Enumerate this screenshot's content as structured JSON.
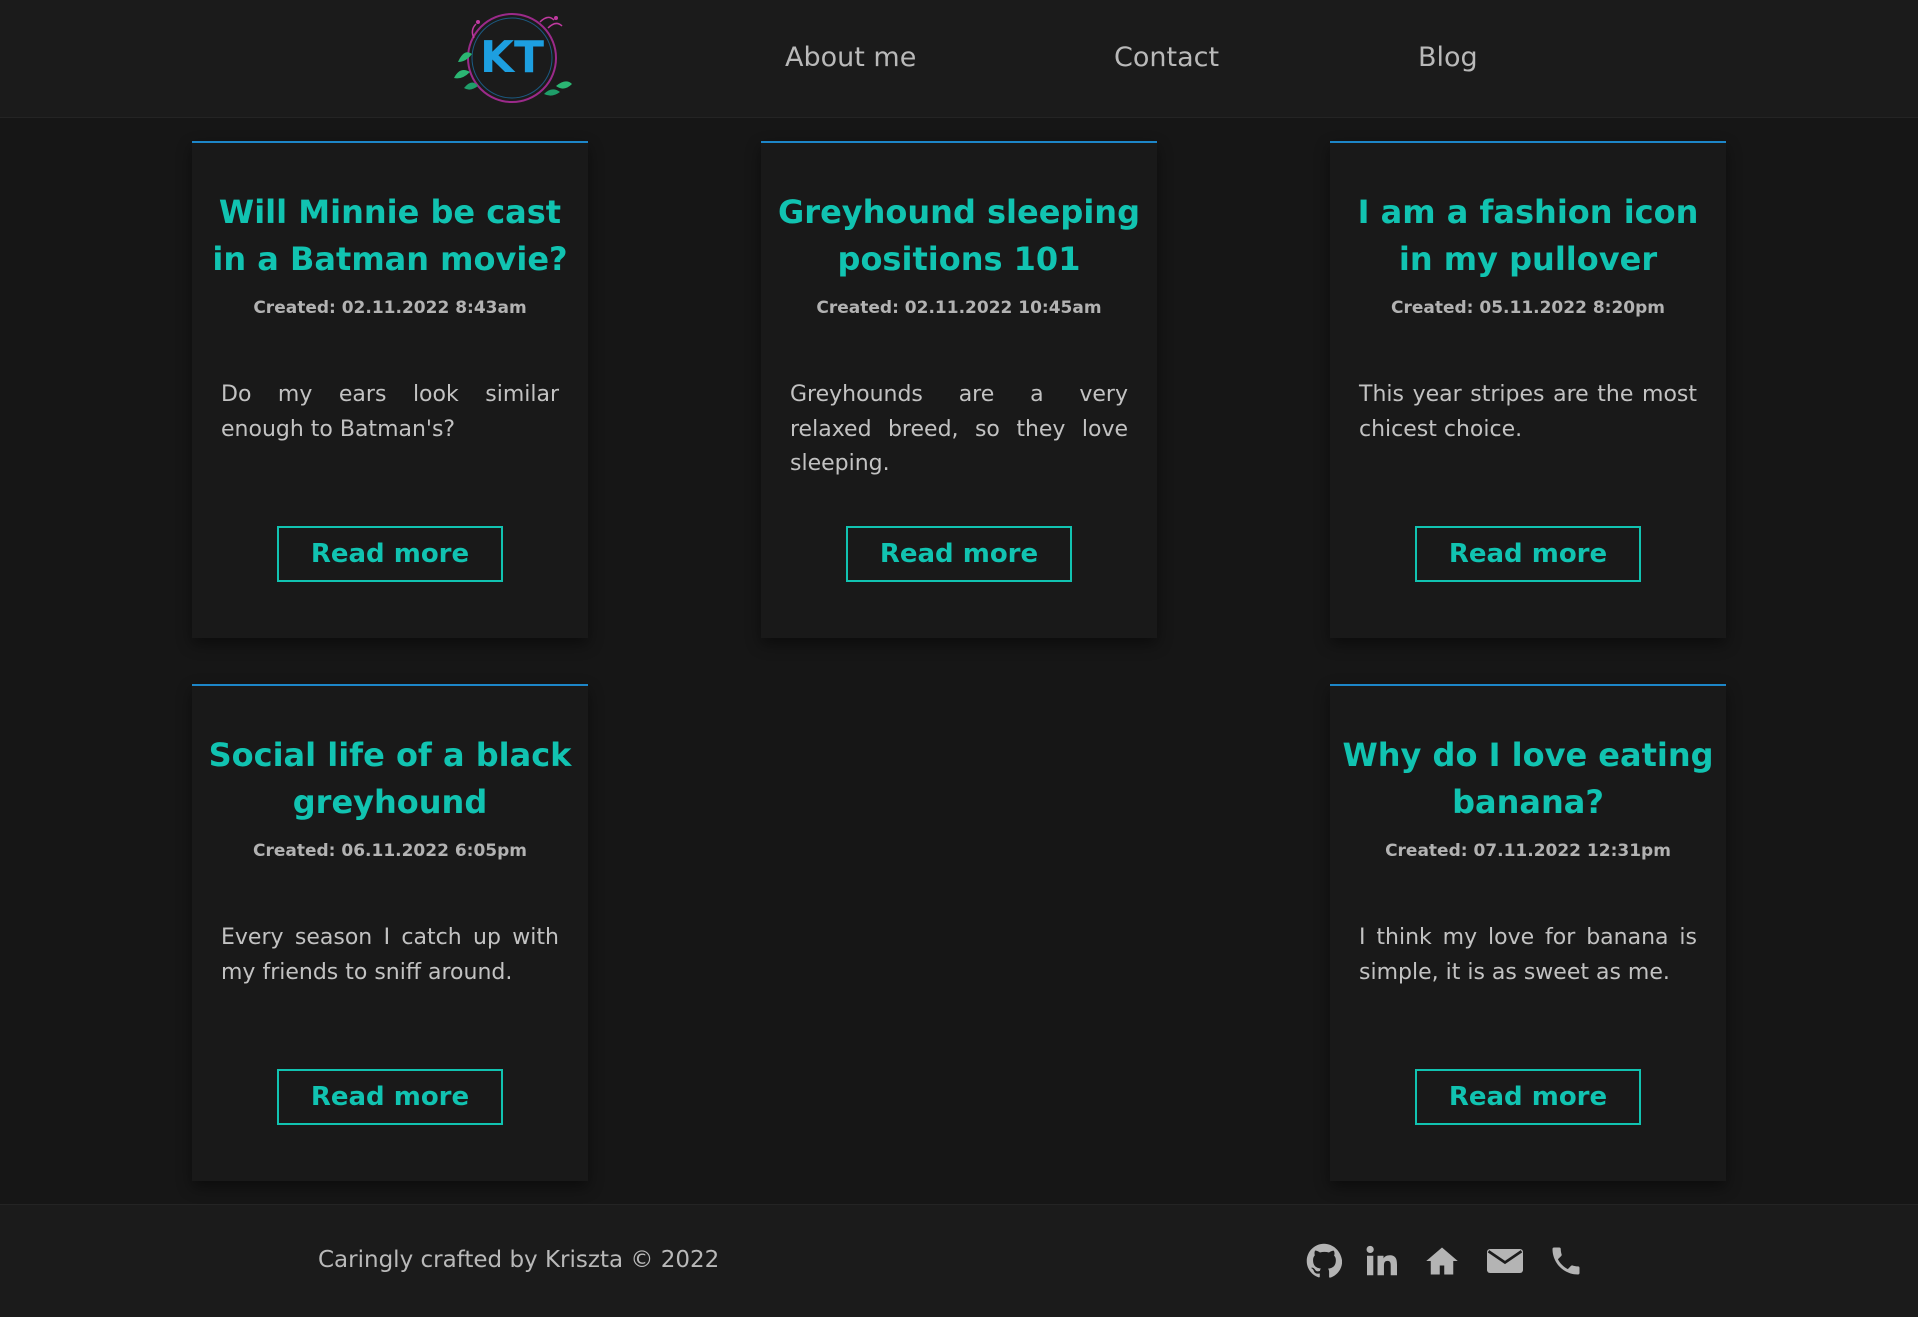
{
  "header": {
    "logo_text": "KT",
    "nav": [
      {
        "label": "About me"
      },
      {
        "label": "Contact"
      },
      {
        "label": "Blog"
      }
    ]
  },
  "posts": [
    {
      "title": "Will Minnie be cast in a Batman movie?",
      "created": "Created: 02.11.2022 8:43am",
      "excerpt": "Do my ears look similar enough to Batman's?",
      "button": "Read more"
    },
    {
      "title": "Greyhound sleeping positions 101",
      "created": "Created: 02.11.2022 10:45am",
      "excerpt": "Greyhounds are a very relaxed breed, so they love sleeping.",
      "button": "Read more"
    },
    {
      "title": "I am a fashion icon in my pullover",
      "created": "Created: 05.11.2022 8:20pm",
      "excerpt": "This year stripes are the most chicest choice.",
      "button": "Read more"
    },
    {
      "title": "Social life of a black greyhound",
      "created": "Created: 06.11.2022 6:05pm",
      "excerpt": "Every season I catch up with my friends to sniff around.",
      "button": "Read more"
    },
    {
      "title": "Why do I love eating banana?",
      "created": "Created: 07.11.2022 12:31pm",
      "excerpt": "I think my love for banana is simple, it is as sweet as me.",
      "button": "Read more"
    }
  ],
  "footer": {
    "credit": "Caringly crafted by Kriszta © 2022",
    "social": [
      {
        "icon": "github-icon"
      },
      {
        "icon": "linkedin-icon"
      },
      {
        "icon": "home-icon"
      },
      {
        "icon": "envelope-icon"
      },
      {
        "icon": "phone-icon"
      }
    ]
  },
  "colors": {
    "background": "#161616",
    "header": "#1b1b1b",
    "accent": "#11c3b1",
    "card_border": "#1d86c8",
    "nav_text": "#b9b9b9"
  }
}
